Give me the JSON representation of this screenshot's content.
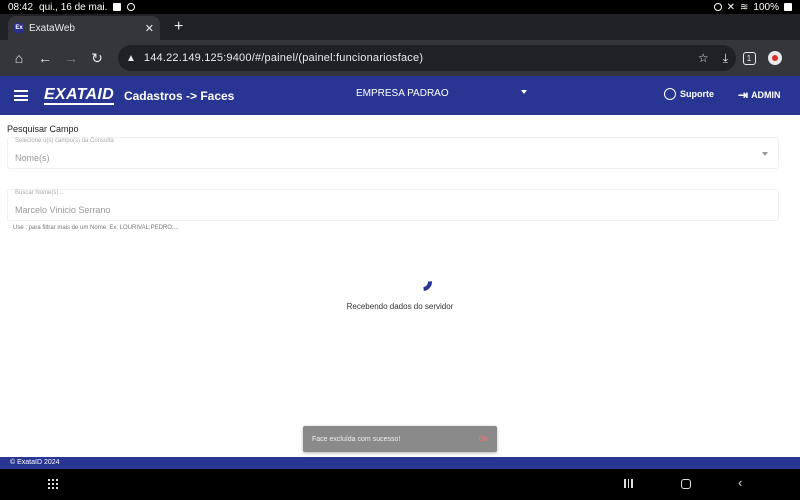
{
  "status_bar": {
    "time": "08:42",
    "date": "qui., 16 de mai.",
    "battery": "100%"
  },
  "browser": {
    "tab_title": "ExataWeb",
    "favicon_text": "Ex",
    "url": "144.22.149.125:9400/#/painel/(painel:funcionariosface)",
    "tab_count": "1"
  },
  "header": {
    "logo": "EXATAID",
    "section": "Cadastros -> Faces",
    "company": "EMPRESA PADRAO",
    "support": "Suporte",
    "user": "ADMIN"
  },
  "form": {
    "label": "Pesquisar Campo",
    "select": {
      "float_label": "Selecione o(s) campo(s) da Consulta",
      "value": "Nome(s)"
    },
    "search": {
      "float_label": "Buscar Nome(s)...",
      "value": "Marcelo Vinicio Serrano"
    },
    "hint": "Use ; para filtrar mais de um Nome. Ex: LOURIVAL;PEDRO;..."
  },
  "loading": {
    "text": "Recebendo dados do servidor"
  },
  "snackbar": {
    "message": "Face excluída com sucesso!",
    "action": "Ok"
  },
  "footer": {
    "text": "© ExataID 2024"
  },
  "colors": {
    "primary": "#283593",
    "browser_dark": "#35363a",
    "snackbar_bg": "#8a8a8a"
  }
}
